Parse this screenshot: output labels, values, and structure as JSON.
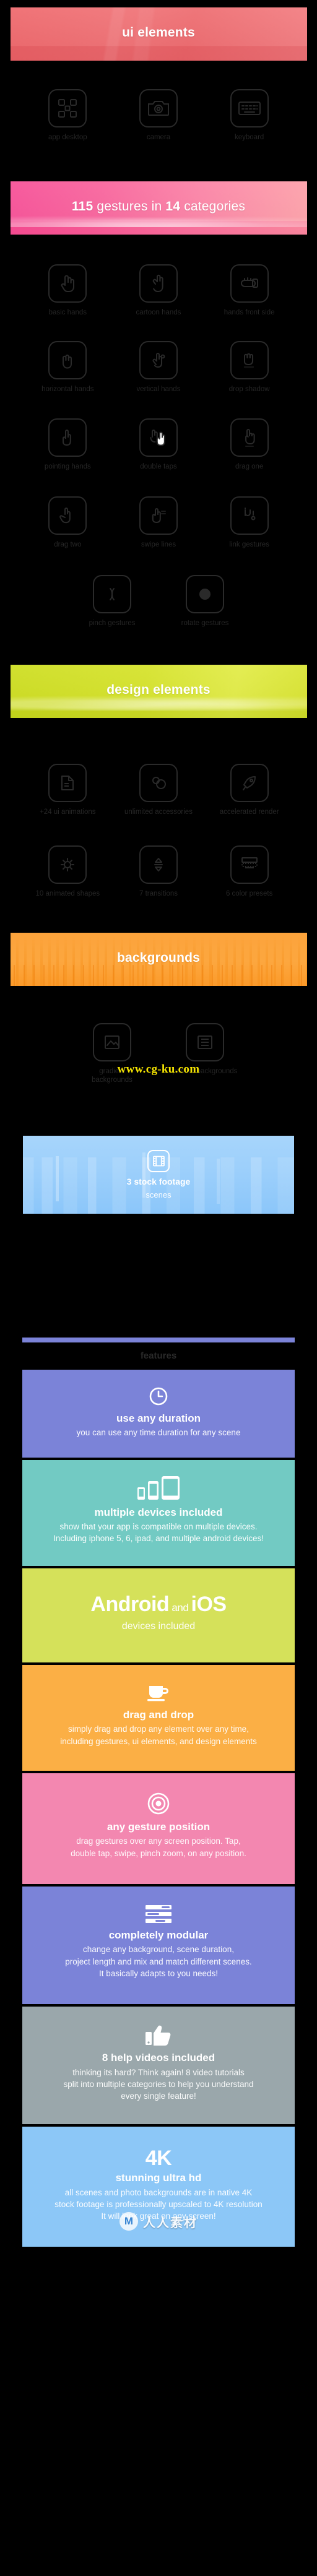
{
  "sections": {
    "ui_elements": {
      "banner_title": "ui elements",
      "items": [
        {
          "label": "app desktop",
          "icon": "app-desktop-icon"
        },
        {
          "label": "camera",
          "icon": "camera-icon"
        },
        {
          "label": "keyboard",
          "icon": "keyboard-icon"
        }
      ]
    },
    "gestures": {
      "banner_count": "115",
      "banner_mid": " gestures in ",
      "banner_count2": "14",
      "banner_end": " categories",
      "banner_title_plain": "115 gestures in 14 categories",
      "items": [
        {
          "label": "basic hands",
          "icon": "basic-hand-icon"
        },
        {
          "label": "cartoon hands",
          "icon": "cartoon-hand-icon"
        },
        {
          "label": "hands front side",
          "icon": "hand-front-side-icon"
        },
        {
          "label": "horizontal hands",
          "icon": "horizontal-hand-icon"
        },
        {
          "label": "vertical hands",
          "icon": "vertical-hand-icon"
        },
        {
          "label": "drop shadow",
          "icon": "drop-shadow-icon"
        },
        {
          "label": "pointing hands",
          "icon": "pointing-hand-icon"
        },
        {
          "label": "double taps",
          "icon": "double-tap-icon"
        },
        {
          "label": "drag one",
          "icon": "drag-one-icon"
        },
        {
          "label": "drag two",
          "icon": "drag-two-icon"
        },
        {
          "label": "swipe lines",
          "icon": "swipe-lines-icon"
        },
        {
          "label": "link gestures",
          "icon": "link-gesture-icon"
        },
        {
          "label": "pinch gestures",
          "icon": "pinch-gesture-icon"
        },
        {
          "label": "rotate gestures",
          "icon": "rotate-gesture-icon"
        }
      ]
    },
    "design_elements": {
      "banner_title": "design elements",
      "items": [
        {
          "label": "+24 ui animations",
          "icon": "ui-animations-icon"
        },
        {
          "label": "unlimited accessories",
          "icon": "accessories-icon"
        },
        {
          "label": "accelerated render",
          "icon": "rocket-icon"
        },
        {
          "label": "10 animated shapes",
          "icon": "animated-shapes-icon"
        },
        {
          "label": "7 transitions",
          "icon": "transitions-icon"
        },
        {
          "label": "6 color presets",
          "icon": "color-presets-icon"
        }
      ]
    },
    "backgrounds": {
      "banner_title": "backgrounds",
      "items": [
        {
          "label": "gradient backgrounds",
          "icon": "gradient-background-icon"
        },
        {
          "label": "pattern backgrounds",
          "icon": "pattern-background-icon"
        }
      ]
    },
    "stock_footage": {
      "title": "3 stock footage",
      "subtitle": "scenes",
      "icon": "film-strip-icon"
    },
    "features_divider": {
      "label": "features"
    },
    "features": [
      {
        "icon": "clock-icon",
        "title": "use any duration",
        "body": "you can use any time duration for any scene",
        "color": "#7b83d8"
      },
      {
        "icon": "devices-icon",
        "title": "multiple devices included",
        "body": "show that your app is compatible on multiple devices.\nIncluding iphone 5, 6, ipad, and multiple android devices!",
        "color": "#72cac3"
      },
      {
        "icon": "",
        "title": "Android and iOS",
        "title_main": "Android",
        "title_join": " and ",
        "title_alt": "iOS",
        "body": "devices included",
        "color": "#d5e15a",
        "style": "big"
      },
      {
        "icon": "cup-icon",
        "title": "drag and drop",
        "body": "simply drag and drop any element over any time,\nincluding gestures, ui elements, and design elements",
        "color": "#fbaf45"
      },
      {
        "icon": "target-icon",
        "title": "any gesture position",
        "body": "drag gestures over any screen position. Tap,\ndouble tap, swipe, pinch zoom, on any position.",
        "color": "#f387b0"
      },
      {
        "icon": "modular-icon",
        "title": "completely modular",
        "body": "change any background, scene duration,\nproject length and mix and match different scenes.\nIt basically adapts to you needs!",
        "color": "#7b83d8"
      },
      {
        "icon": "thumbs-up-icon",
        "title": "8 help videos included",
        "body": "thinking its hard? Think again! 8 video tutorials\nsplit into multiple categories to help you understand\nevery single feature!",
        "color": "#9aa7ab"
      },
      {
        "icon": "",
        "badge": "4K",
        "title": "stunning ultra hd",
        "body": "all scenes and  photo backgrounds are in native 4K\nstock footage is professionally upscaled to 4K resolution\nIt will look great on any screen!",
        "color": "#8cc7f7"
      }
    ]
  },
  "watermarks": {
    "cgku": "www.cg-ku.com",
    "renren_mark": "M",
    "renren_text": "人人素材"
  }
}
